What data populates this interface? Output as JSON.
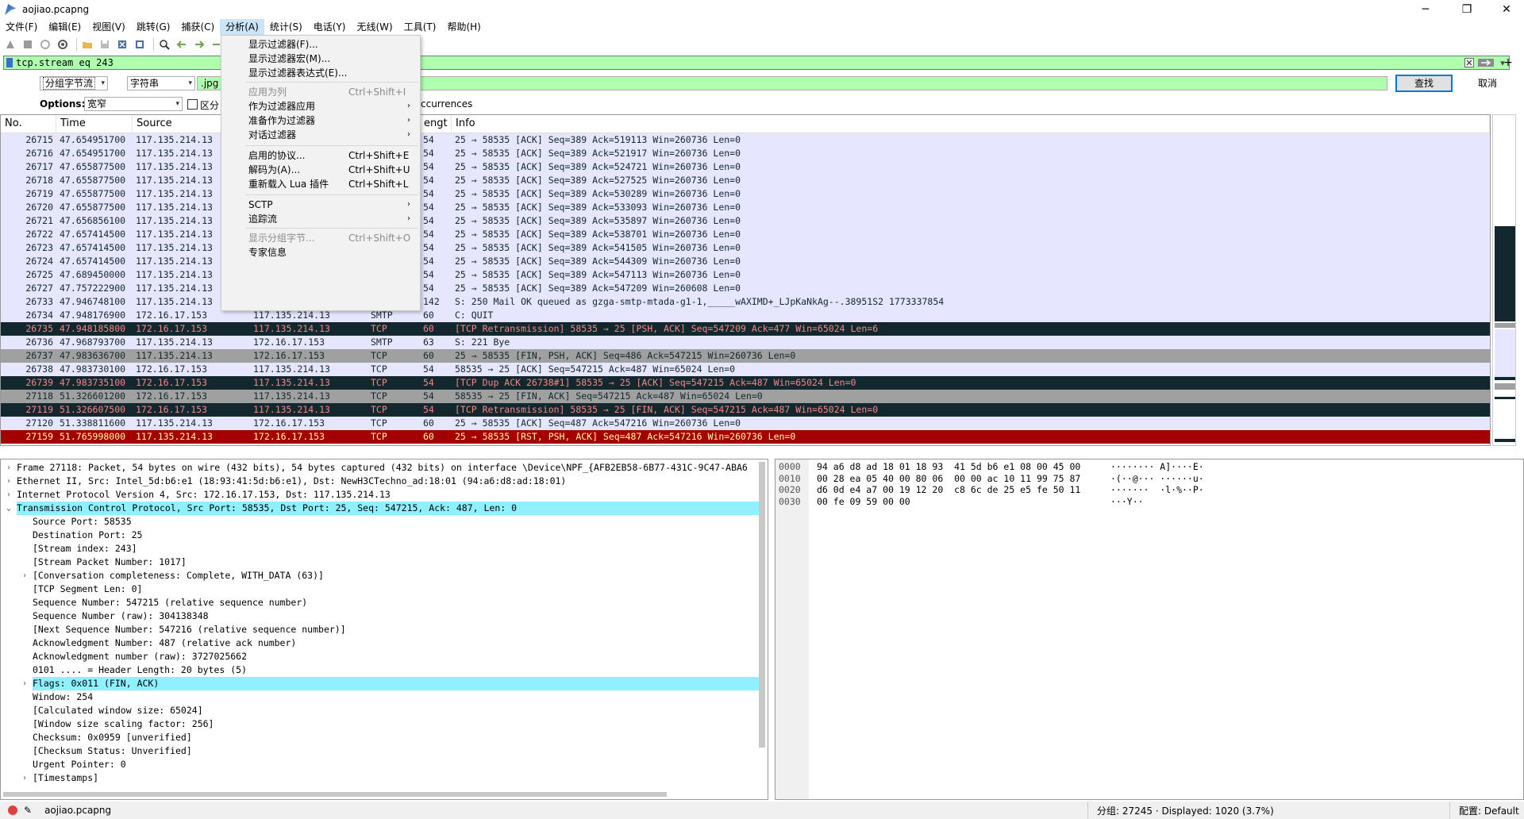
{
  "window": {
    "title": "aojiao.pcapng",
    "minimize": "─",
    "maximize": "❐",
    "close": "✕"
  },
  "menubar": [
    "文件(F)",
    "编辑(E)",
    "视图(V)",
    "跳转(G)",
    "捕获(C)",
    "分析(A)",
    "统计(S)",
    "电话(Y)",
    "无线(W)",
    "工具(T)",
    "帮助(H)"
  ],
  "filter": {
    "value": "tcp.stream eq 243",
    "plus": "+"
  },
  "findbar": {
    "search_in": "分组字节流",
    "type": "字符串",
    "value": ".jpg",
    "find_button": "查找",
    "cancel_button": "取消"
  },
  "options": {
    "label": "Options:",
    "charset": "宽窄",
    "case_label": "区分",
    "occurrences": "ccurrences"
  },
  "columns": {
    "no": "No.",
    "time": "Time",
    "source": "Source",
    "length": "engt",
    "info": "Info"
  },
  "packets": [
    {
      "no": "26715",
      "time": "47.654951700",
      "src": "117.135.214.13",
      "dst": "",
      "proto": "",
      "len": "54",
      "info": "25 → 58535 [ACK] Seq=389 Ack=519113 Win=260736 Len=0",
      "style": "r-tcp"
    },
    {
      "no": "26716",
      "time": "47.654951700",
      "src": "117.135.214.13",
      "dst": "",
      "proto": "",
      "len": "54",
      "info": "25 → 58535 [ACK] Seq=389 Ack=521917 Win=260736 Len=0",
      "style": "r-tcp"
    },
    {
      "no": "26717",
      "time": "47.655877500",
      "src": "117.135.214.13",
      "dst": "",
      "proto": "",
      "len": "54",
      "info": "25 → 58535 [ACK] Seq=389 Ack=524721 Win=260736 Len=0",
      "style": "r-tcp"
    },
    {
      "no": "26718",
      "time": "47.655877500",
      "src": "117.135.214.13",
      "dst": "",
      "proto": "",
      "len": "54",
      "info": "25 → 58535 [ACK] Seq=389 Ack=527525 Win=260736 Len=0",
      "style": "r-tcp"
    },
    {
      "no": "26719",
      "time": "47.655877500",
      "src": "117.135.214.13",
      "dst": "",
      "proto": "",
      "len": "54",
      "info": "25 → 58535 [ACK] Seq=389 Ack=530289 Win=260736 Len=0",
      "style": "r-tcp"
    },
    {
      "no": "26720",
      "time": "47.655877500",
      "src": "117.135.214.13",
      "dst": "",
      "proto": "",
      "len": "54",
      "info": "25 → 58535 [ACK] Seq=389 Ack=533093 Win=260736 Len=0",
      "style": "r-tcp"
    },
    {
      "no": "26721",
      "time": "47.656856100",
      "src": "117.135.214.13",
      "dst": "",
      "proto": "",
      "len": "54",
      "info": "25 → 58535 [ACK] Seq=389 Ack=535897 Win=260736 Len=0",
      "style": "r-tcp"
    },
    {
      "no": "26722",
      "time": "47.657414500",
      "src": "117.135.214.13",
      "dst": "",
      "proto": "",
      "len": "54",
      "info": "25 → 58535 [ACK] Seq=389 Ack=538701 Win=260736 Len=0",
      "style": "r-tcp"
    },
    {
      "no": "26723",
      "time": "47.657414500",
      "src": "117.135.214.13",
      "dst": "",
      "proto": "",
      "len": "54",
      "info": "25 → 58535 [ACK] Seq=389 Ack=541505 Win=260736 Len=0",
      "style": "r-tcp"
    },
    {
      "no": "26724",
      "time": "47.657414500",
      "src": "117.135.214.13",
      "dst": "",
      "proto": "",
      "len": "54",
      "info": "25 → 58535 [ACK] Seq=389 Ack=544309 Win=260736 Len=0",
      "style": "r-tcp"
    },
    {
      "no": "26725",
      "time": "47.689450000",
      "src": "117.135.214.13",
      "dst": "",
      "proto": "",
      "len": "54",
      "info": "25 → 58535 [ACK] Seq=389 Ack=547113 Win=260736 Len=0",
      "style": "r-tcp"
    },
    {
      "no": "26727",
      "time": "47.757222900",
      "src": "117.135.214.13",
      "dst": "",
      "proto": "",
      "len": "54",
      "info": "25 → 58535 [ACK] Seq=389 Ack=547209 Win=260608 Len=0",
      "style": "r-tcp"
    },
    {
      "no": "26733",
      "time": "47.946748100",
      "src": "117.135.214.13",
      "dst": "",
      "proto": "",
      "len": "142",
      "info": "S: 250 Mail OK queued as gzga-smtp-mtada-g1-1,_____wAXIMD+_LJpKaNkAg--.38951S2 1773337854",
      "style": "r-tcp"
    },
    {
      "no": "26734",
      "time": "47.948176900",
      "src": "172.16.17.153",
      "dst": "117.135.214.13",
      "proto": "SMTP",
      "len": "60",
      "info": "C: QUIT",
      "style": "r-tcp"
    },
    {
      "no": "26735",
      "time": "47.948185800",
      "src": "172.16.17.153",
      "dst": "117.135.214.13",
      "proto": "TCP",
      "len": "60",
      "info": "[TCP Retransmission] 58535 → 25 [PSH, ACK] Seq=547209 Ack=477 Win=65024 Len=6",
      "style": "r-dark"
    },
    {
      "no": "26736",
      "time": "47.968793700",
      "src": "117.135.214.13",
      "dst": "172.16.17.153",
      "proto": "SMTP",
      "len": "63",
      "info": "S: 221 Bye",
      "style": "r-tcp"
    },
    {
      "no": "26737",
      "time": "47.983636700",
      "src": "117.135.214.13",
      "dst": "172.16.17.153",
      "proto": "TCP",
      "len": "60",
      "info": "25 → 58535 [FIN, PSH, ACK] Seq=486 Ack=547215 Win=260736 Len=0",
      "style": "r-gray"
    },
    {
      "no": "26738",
      "time": "47.983730100",
      "src": "172.16.17.153",
      "dst": "117.135.214.13",
      "proto": "TCP",
      "len": "54",
      "info": "58535 → 25 [ACK] Seq=547215 Ack=487 Win=65024 Len=0",
      "style": "r-tcp"
    },
    {
      "no": "26739",
      "time": "47.983735100",
      "src": "172.16.17.153",
      "dst": "117.135.214.13",
      "proto": "TCP",
      "len": "54",
      "info": "[TCP Dup ACK 26738#1] 58535 → 25 [ACK] Seq=547215 Ack=487 Win=65024 Len=0",
      "style": "r-dark"
    },
    {
      "no": "27118",
      "time": "51.326601200",
      "src": "172.16.17.153",
      "dst": "117.135.214.13",
      "proto": "TCP",
      "len": "54",
      "info": "58535 → 25 [FIN, ACK] Seq=547215 Ack=487 Win=65024 Len=0",
      "style": "r-gray"
    },
    {
      "no": "27119",
      "time": "51.326607500",
      "src": "172.16.17.153",
      "dst": "117.135.214.13",
      "proto": "TCP",
      "len": "54",
      "info": "[TCP Retransmission] 58535 → 25 [FIN, ACK] Seq=547215 Ack=487 Win=65024 Len=0",
      "style": "r-dark"
    },
    {
      "no": "27120",
      "time": "51.338811600",
      "src": "117.135.214.13",
      "dst": "172.16.17.153",
      "proto": "TCP",
      "len": "60",
      "info": "25 → 58535 [ACK] Seq=487 Ack=547216 Win=260736 Len=0",
      "style": "r-tcp"
    },
    {
      "no": "27159",
      "time": "51.765998000",
      "src": "117.135.214.13",
      "dst": "172.16.17.153",
      "proto": "TCP",
      "len": "60",
      "info": "25 → 58535 [RST, PSH, ACK] Seq=487 Ack=547216 Win=260736 Len=0",
      "style": "r-red"
    }
  ],
  "details": [
    {
      "indent": 0,
      "tw": "›",
      "text": "Frame 27118: Packet, 54 bytes on wire (432 bits), 54 bytes captured (432 bits) on interface \\Device\\NPF_{AFB2EB58-6B77-431C-9C47-ABA6",
      "sel": false
    },
    {
      "indent": 0,
      "tw": "›",
      "text": "Ethernet II, Src: Intel_5d:b6:e1 (18:93:41:5d:b6:e1), Dst: NewH3CTechno_ad:18:01 (94:a6:d8:ad:18:01)",
      "sel": false
    },
    {
      "indent": 0,
      "tw": "›",
      "text": "Internet Protocol Version 4, Src: 172.16.17.153, Dst: 117.135.214.13",
      "sel": false
    },
    {
      "indent": 0,
      "tw": "⌄",
      "text": "Transmission Control Protocol, Src Port: 58535, Dst Port: 25, Seq: 547215, Ack: 487, Len: 0",
      "sel": true
    },
    {
      "indent": 1,
      "tw": "",
      "text": "Source Port: 58535",
      "sel": false
    },
    {
      "indent": 1,
      "tw": "",
      "text": "Destination Port: 25",
      "sel": false
    },
    {
      "indent": 1,
      "tw": "",
      "text": "[Stream index: 243]",
      "sel": false
    },
    {
      "indent": 1,
      "tw": "",
      "text": "[Stream Packet Number: 1017]",
      "sel": false
    },
    {
      "indent": 1,
      "tw": "›",
      "text": "[Conversation completeness: Complete, WITH_DATA (63)]",
      "sel": false
    },
    {
      "indent": 1,
      "tw": "",
      "text": "[TCP Segment Len: 0]",
      "sel": false
    },
    {
      "indent": 1,
      "tw": "",
      "text": "Sequence Number: 547215    (relative sequence number)",
      "sel": false
    },
    {
      "indent": 1,
      "tw": "",
      "text": "Sequence Number (raw): 304138348",
      "sel": false
    },
    {
      "indent": 1,
      "tw": "",
      "text": "[Next Sequence Number: 547216    (relative sequence number)]",
      "sel": false
    },
    {
      "indent": 1,
      "tw": "",
      "text": "Acknowledgment Number: 487    (relative ack number)",
      "sel": false
    },
    {
      "indent": 1,
      "tw": "",
      "text": "Acknowledgment number (raw): 3727025662",
      "sel": false
    },
    {
      "indent": 1,
      "tw": "",
      "text": "0101 .... = Header Length: 20 bytes (5)",
      "sel": false
    },
    {
      "indent": 1,
      "tw": "›",
      "text": "Flags: 0x011 (FIN, ACK)",
      "sel": true
    },
    {
      "indent": 1,
      "tw": "",
      "text": "Window: 254",
      "sel": false
    },
    {
      "indent": 1,
      "tw": "",
      "text": "[Calculated window size: 65024]",
      "sel": false
    },
    {
      "indent": 1,
      "tw": "",
      "text": "[Window size scaling factor: 256]",
      "sel": false
    },
    {
      "indent": 1,
      "tw": "",
      "text": "Checksum: 0x0959 [unverified]",
      "sel": false
    },
    {
      "indent": 1,
      "tw": "",
      "text": "[Checksum Status: Unverified]",
      "sel": false
    },
    {
      "indent": 1,
      "tw": "",
      "text": "Urgent Pointer: 0",
      "sel": false
    },
    {
      "indent": 1,
      "tw": "›",
      "text": "[Timestamps]",
      "sel": false
    }
  ],
  "hex": [
    {
      "off": "0000",
      "bytes": "94 a6 d8 ad 18 01 18 93  41 5d b6 e1 08 00 45 00",
      "ascii": "········ A]····E·"
    },
    {
      "off": "0010",
      "bytes": "00 28 ea 05 40 00 80 06  00 00 ac 10 11 99 75 87",
      "ascii": "·(··@··· ······u·"
    },
    {
      "off": "0020",
      "bytes": "d6 0d e4 a7 00 19 12 20  c8 6c de 25 e5 fe 50 11",
      "ascii": "·······  ·l·%··P·"
    },
    {
      "off": "0030",
      "bytes": "00 fe 09 59 00 00",
      "ascii": "···Y··"
    }
  ],
  "status": {
    "file": "aojiao.pcapng",
    "counts": "分组: 27245 · Displayed: 1020 (3.7%)",
    "profile": "配置: Default"
  },
  "analyze_menu": [
    {
      "label": "显示过滤器(F)...",
      "shortcut": "",
      "arrow": false,
      "disabled": false
    },
    {
      "label": "显示过滤器宏(M)...",
      "shortcut": "",
      "arrow": false,
      "disabled": false
    },
    {
      "label": "显示过滤器表达式(E)...",
      "shortcut": "",
      "arrow": false,
      "disabled": false
    },
    {
      "label": "应用为列",
      "shortcut": "Ctrl+Shift+I",
      "arrow": false,
      "disabled": true
    },
    {
      "label": "作为过滤器应用",
      "shortcut": "",
      "arrow": true,
      "disabled": false
    },
    {
      "label": "准备作为过滤器",
      "shortcut": "",
      "arrow": true,
      "disabled": false
    },
    {
      "label": "对话过滤器",
      "shortcut": "",
      "arrow": true,
      "disabled": false
    },
    {
      "label": "启用的协议...",
      "shortcut": "Ctrl+Shift+E",
      "arrow": false,
      "disabled": false
    },
    {
      "label": "解码为(A)...",
      "shortcut": "Ctrl+Shift+U",
      "arrow": false,
      "disabled": false
    },
    {
      "label": "重新载入 Lua 插件",
      "shortcut": "Ctrl+Shift+L",
      "arrow": false,
      "disabled": false
    },
    {
      "label": "SCTP",
      "shortcut": "",
      "arrow": true,
      "disabled": false
    },
    {
      "label": "追踪流",
      "shortcut": "",
      "arrow": true,
      "disabled": false
    },
    {
      "label": "显示分组字节...",
      "shortcut": "Ctrl+Shift+O",
      "arrow": false,
      "disabled": true
    },
    {
      "label": "专家信息",
      "shortcut": "",
      "arrow": false,
      "disabled": false
    }
  ]
}
